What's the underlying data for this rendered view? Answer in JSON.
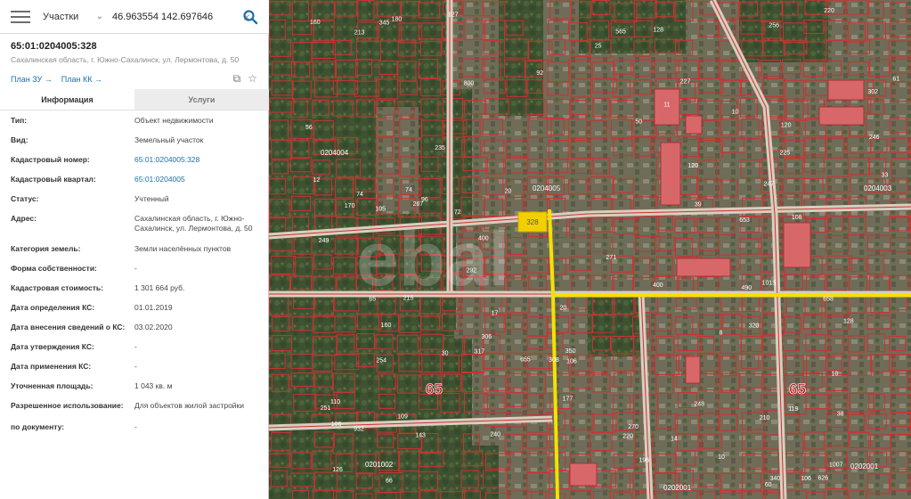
{
  "search": {
    "layer": "Участки",
    "query": "46.963554 142.697646"
  },
  "object": {
    "cadastral_number": "65:01:0204005:328",
    "address_short": "Сахалинская область, г. Южно-Сахалинск, ул. Лермонтова, д. 50"
  },
  "links": {
    "plan_zu": "План ЗУ →",
    "plan_kk": "План КК →"
  },
  "tabs": [
    {
      "label": "Информация",
      "active": true
    },
    {
      "label": "Услуги",
      "active": false
    }
  ],
  "properties": [
    {
      "label": "Тип:",
      "value": "Объект недвижимости"
    },
    {
      "label": "Вид:",
      "value": "Земельный участок"
    },
    {
      "label": "Кадастровый номер:",
      "value": "65:01:0204005:328",
      "link": true
    },
    {
      "label": "Кадастровый квартал:",
      "value": "65:01:0204005",
      "link": true
    },
    {
      "label": "Статус:",
      "value": "Учтенный"
    },
    {
      "label": "Адрес:",
      "value": "Сахалинская область, г. Южно-Сахалинск, ул. Лермонтова, д. 50"
    },
    {
      "label": "Категория земель:",
      "value": "Земли населённых пунктов"
    },
    {
      "label": "Форма собственности:",
      "value": "-"
    },
    {
      "label": "Кадастровая стоимость:",
      "value": "1 301 664 руб."
    },
    {
      "label": "Дата определения КС:",
      "value": "01.01.2019"
    },
    {
      "label": "Дата внесения сведений о КС:",
      "value": "03.02.2020"
    },
    {
      "label": "Дата утверждения КС:",
      "value": "-"
    },
    {
      "label": "Дата применения КС:",
      "value": "-"
    },
    {
      "label": "Уточненная площадь:",
      "value": "1 043 кв. м"
    },
    {
      "label": "Разрешенное использование:",
      "value": "Для объектов жилой застройки"
    },
    {
      "label": "по документу:",
      "value": "-"
    }
  ],
  "map": {
    "watermark": "ebal",
    "quarter_labels": [
      "0204004",
      "0204005",
      "0204003",
      "0201002",
      "0202001",
      "0202001"
    ],
    "region_labels": [
      "65",
      "65"
    ],
    "selected_parcel_label": "328",
    "parcel_numbers": [
      "20",
      "267",
      "345",
      "1015",
      "626",
      "800",
      "308",
      "292",
      "317",
      "653",
      "108",
      "565",
      "160",
      "340",
      "400",
      "248",
      "271",
      "33",
      "302",
      "20",
      "106",
      "96",
      "14",
      "30",
      "119",
      "39",
      "220",
      "110",
      "120",
      "251",
      "306",
      "655",
      "932",
      "10",
      "10",
      "12",
      "74",
      "180",
      "215",
      "240",
      "249",
      "1007",
      "658",
      "10",
      "106",
      "106",
      "350",
      "235",
      "127",
      "227",
      "196",
      "247",
      "400",
      "256",
      "246",
      "120",
      "143",
      "213",
      "254",
      "109",
      "128",
      "92",
      "56",
      "490",
      "210",
      "170",
      "220",
      "50",
      "8",
      "17",
      "65",
      "74",
      "177",
      "225",
      "38",
      "270",
      "128",
      "105",
      "61",
      "60",
      "72",
      "126",
      "320",
      "11",
      "160",
      "66",
      "25"
    ],
    "colors": {
      "parcel_outline": "#d03030",
      "selected_fill": "#f2d000",
      "road_highlight": "#f5e100",
      "vegetation": "#3f5232",
      "urban": "#77735f"
    }
  }
}
